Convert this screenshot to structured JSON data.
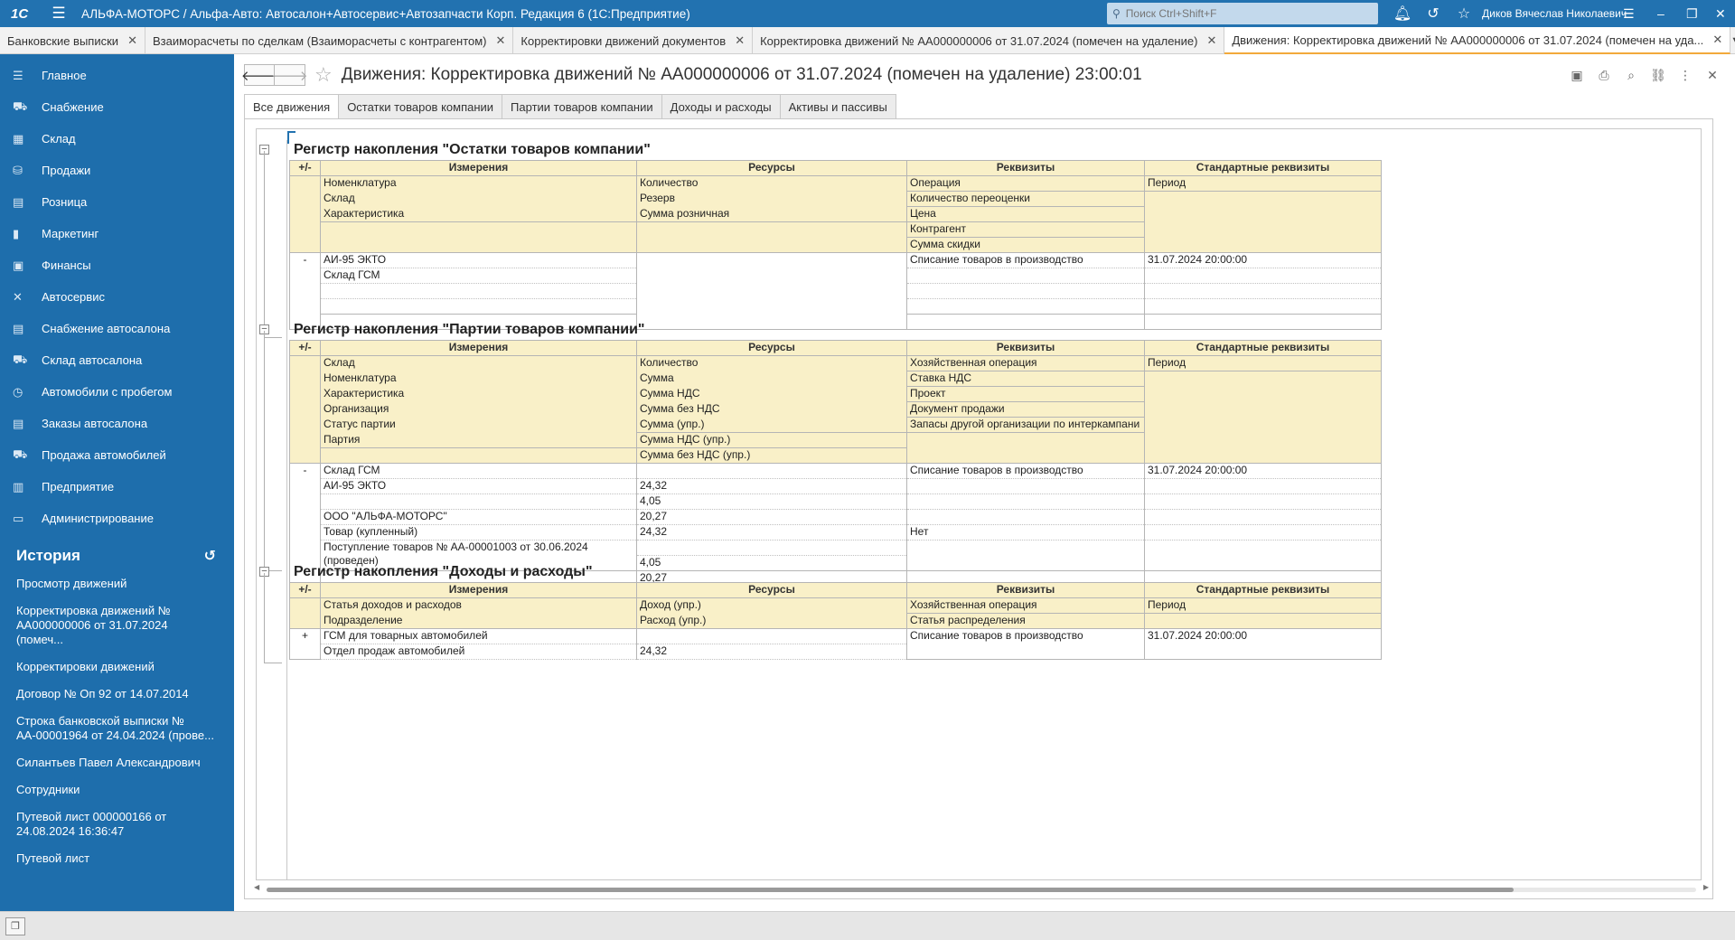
{
  "app": {
    "logo": "1С",
    "title": "АЛЬФА-МОТОРС / Альфа-Авто: Автосалон+Автосервис+Автозапчасти Корп. Редакция 6  (1С:Предприятие)",
    "search_placeholder": "Поиск Ctrl+Shift+F",
    "user": "Диков Вячеслав Николаевич"
  },
  "open_tabs": [
    {
      "label": "Банковские выписки"
    },
    {
      "label": "Взаиморасчеты по сделкам (Взаиморасчеты с контрагентом)"
    },
    {
      "label": "Корректировки движений документов"
    },
    {
      "label": "Корректировка движений № АА000000006 от 31.07.2024 (помечен на удаление)"
    },
    {
      "label": "Движения: Корректировка движений № АА000000006 от 31.07.2024 (помечен на уда..."
    }
  ],
  "sidebar": {
    "items": [
      {
        "label": "Главное",
        "icon": "☰"
      },
      {
        "label": "Снабжение",
        "icon": "⛟"
      },
      {
        "label": "Склад",
        "icon": "▦"
      },
      {
        "label": "Продажи",
        "icon": "⛁"
      },
      {
        "label": "Розница",
        "icon": "▤"
      },
      {
        "label": "Маркетинг",
        "icon": "▮"
      },
      {
        "label": "Финансы",
        "icon": "▣"
      },
      {
        "label": "Автосервис",
        "icon": "✕"
      },
      {
        "label": "Снабжение автосалона",
        "icon": "▤"
      },
      {
        "label": "Склад автосалона",
        "icon": "⛟"
      },
      {
        "label": "Автомобили с пробегом",
        "icon": "◷"
      },
      {
        "label": "Заказы автосалона",
        "icon": "▤"
      },
      {
        "label": "Продажа автомобилей",
        "icon": "⛟"
      },
      {
        "label": "Предприятие",
        "icon": "▥"
      },
      {
        "label": "Администрирование",
        "icon": "▭"
      }
    ],
    "history_title": "История",
    "history": [
      {
        "label": "Просмотр движений"
      },
      {
        "label": "Корректировка движений № АА000000006 от 31.07.2024 (помеч..."
      },
      {
        "label": "Корректировки движений"
      },
      {
        "label": "Договор № Оп 92 от 14.07.2014"
      },
      {
        "label": "Строка банковской выписки № АА-00001964 от 24.04.2024 (прове..."
      },
      {
        "label": "Силантьев Павел Александрович"
      },
      {
        "label": "Сотрудники"
      },
      {
        "label": "Путевой лист 000000166 от 24.08.2024 16:36:47"
      },
      {
        "label": "Путевой лист"
      }
    ]
  },
  "form": {
    "title": "Движения: Корректировка движений № АА000000006 от 31.07.2024 (помечен на удаление) 23:00:01",
    "tabs": [
      {
        "label": "Все движения"
      },
      {
        "label": "Остатки товаров компании"
      },
      {
        "label": "Партии товаров компании"
      },
      {
        "label": "Доходы и расходы"
      },
      {
        "label": "Активы и пассивы"
      }
    ]
  },
  "headers": {
    "pm": "+/-",
    "dims": "Измерения",
    "res": "Ресурсы",
    "req": "Реквизиты",
    "std": "Стандартные реквизиты"
  },
  "reg1": {
    "title": "Регистр накопления \"Остатки товаров компании\"",
    "h_dims": [
      "Номенклатура",
      "Склад",
      "Характеристика"
    ],
    "h_res": [
      "Количество",
      "Резерв",
      "Сумма розничная"
    ],
    "h_req": [
      "Операция",
      "Количество переоценки",
      "Цена",
      "Контрагент",
      "Сумма скидки"
    ],
    "h_std": [
      "Период"
    ],
    "row": {
      "pm": "-",
      "dims": [
        "АИ-95 ЭКТО",
        "Склад ГСМ"
      ],
      "req": "Списание товаров в производство",
      "std": "31.07.2024 20:00:00"
    }
  },
  "reg2": {
    "title": "Регистр накопления \"Партии товаров компании\"",
    "h_dims": [
      "Склад",
      "Номенклатура",
      "Характеристика",
      "Организация",
      "Статус партии",
      "Партия"
    ],
    "h_res": [
      "Количество",
      "Сумма",
      "Сумма НДС",
      "Сумма без НДС",
      "Сумма (упр.)",
      "Сумма НДС (упр.)",
      "Сумма без НДС (упр.)"
    ],
    "h_req": [
      "Хозяйственная операция",
      "Ставка НДС",
      "Проект",
      "Документ продажи",
      "Запасы другой организации по интеркампани"
    ],
    "h_std": [
      "Период"
    ],
    "row": {
      "pm": "-",
      "dims": [
        "Склад ГСМ",
        "АИ-95 ЭКТО",
        "",
        "ООО \"АЛЬФА-МОТОРС\"",
        "Товар (купленный)",
        "Поступление товаров № АА-00001003 от 30.06.2024 (проведен)"
      ],
      "res": [
        "",
        "24,32",
        "4,05",
        "20,27",
        "24,32",
        "4,05",
        "20,27"
      ],
      "req": [
        "Списание товаров в производство",
        "",
        "",
        "",
        "Нет"
      ],
      "std": "31.07.2024 20:00:00"
    }
  },
  "reg3": {
    "title": "Регистр накопления \"Доходы и расходы\"",
    "h_dims": [
      "Статья доходов и расходов",
      "Подразделение"
    ],
    "h_res": [
      "Доход (упр.)",
      "Расход (упр.)"
    ],
    "h_req": [
      "Хозяйственная операция",
      "Статья распределения"
    ],
    "h_std": [
      "Период"
    ],
    "row": {
      "pm": "+",
      "dims": [
        "ГСМ для товарных автомобилей",
        "Отдел продаж автомобилей"
      ],
      "res": [
        "",
        "24,32"
      ],
      "req": "Списание товаров в производство",
      "std": "31.07.2024 20:00:00"
    }
  }
}
